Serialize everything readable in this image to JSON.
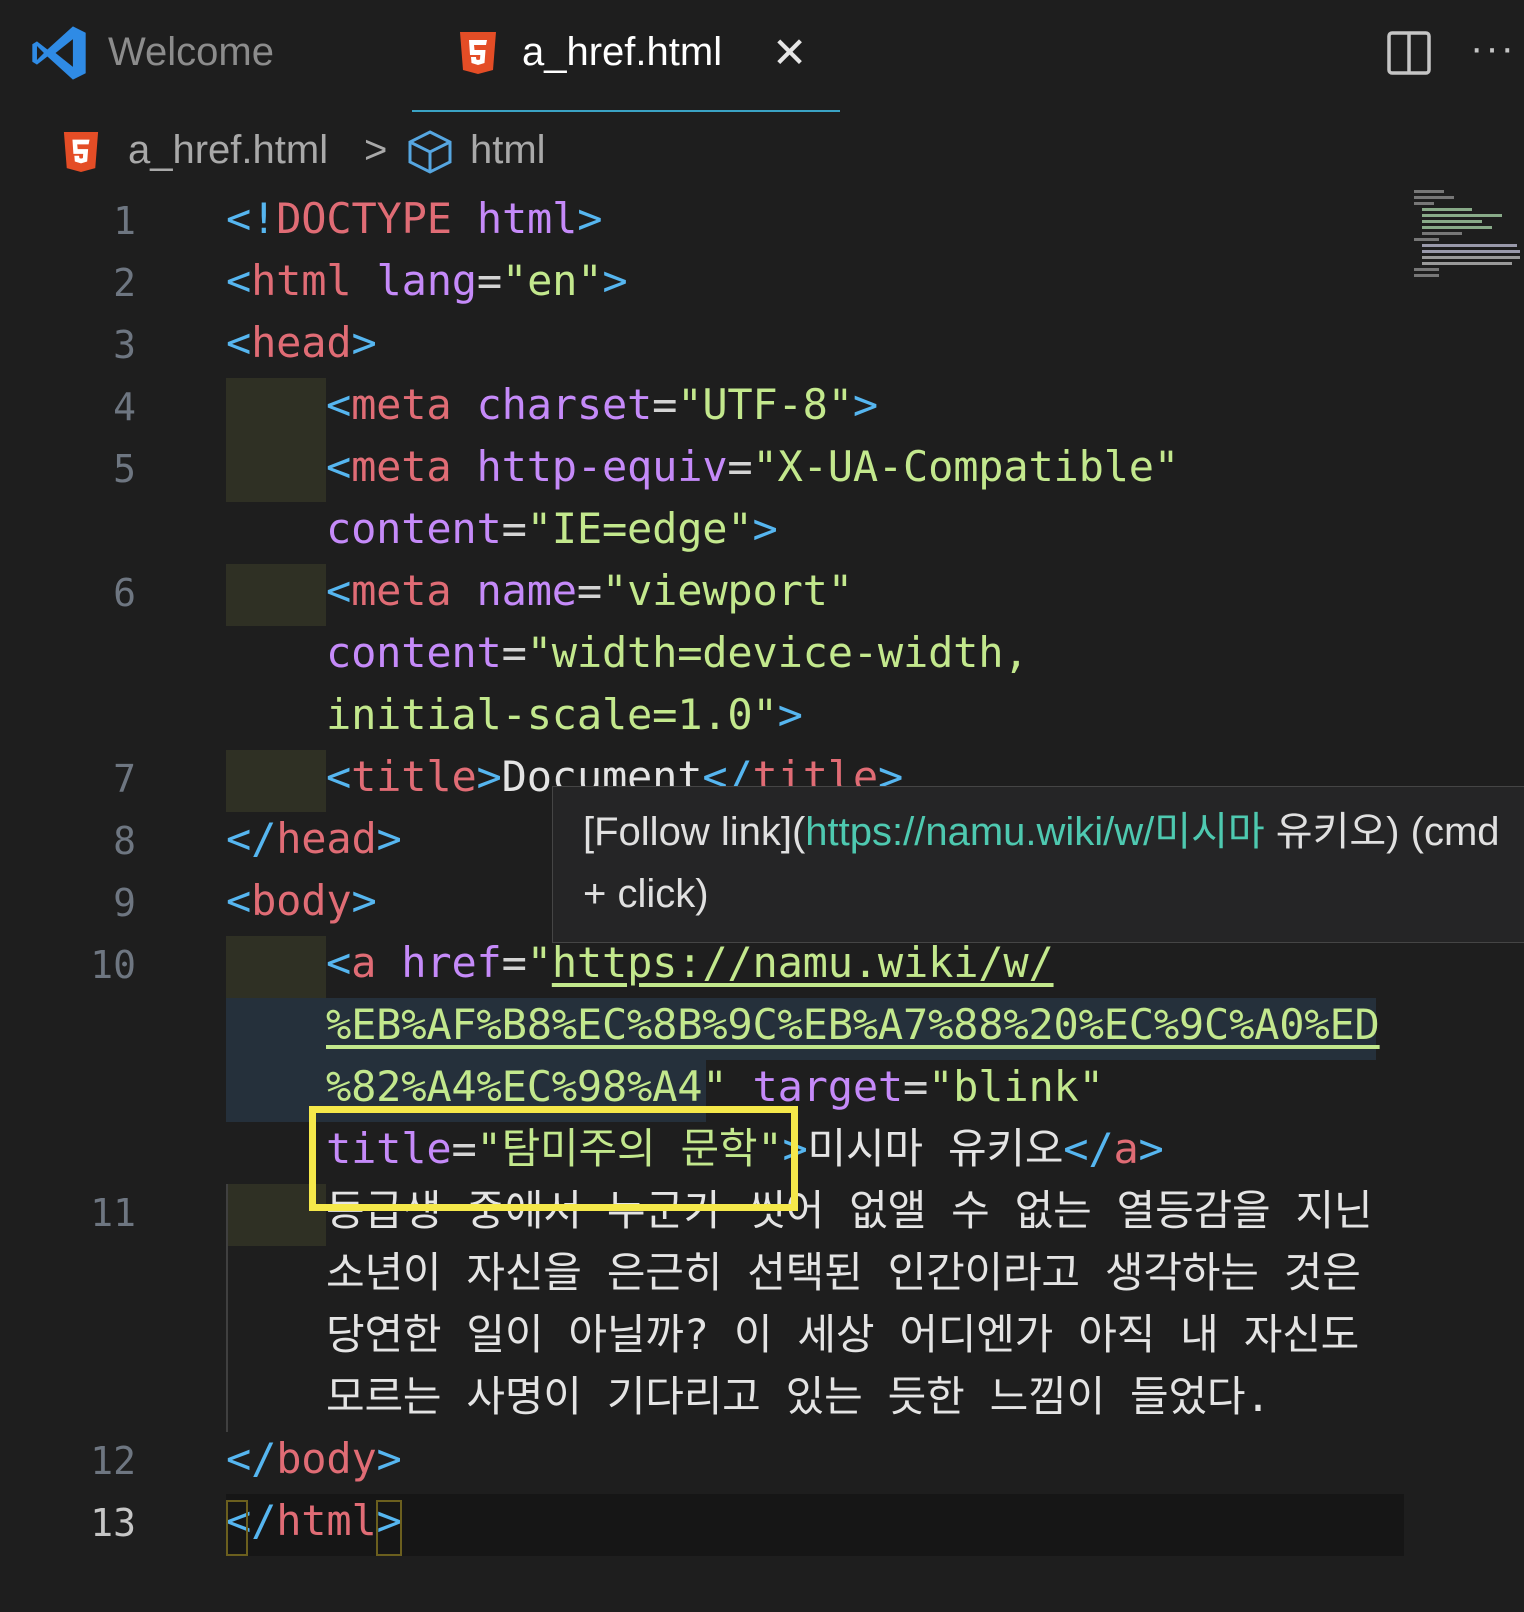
{
  "tabs": {
    "welcome_label": "Welcome",
    "active_label": "a_href.html",
    "close_symbol": "✕",
    "split_symbol": "◫",
    "more_symbol": "···"
  },
  "breadcrumb": {
    "file": "a_href.html",
    "separator": ">",
    "element": "html"
  },
  "line_numbers": [
    "1",
    "2",
    "3",
    "4",
    "5",
    "6",
    "7",
    "8",
    "9",
    "10",
    "11",
    "12",
    "13"
  ],
  "code": {
    "l1": [
      "<!",
      "DOCTYPE",
      " html",
      ">"
    ],
    "l2": [
      "<",
      "html",
      " lang",
      "=",
      "\"en\"",
      ">"
    ],
    "l3": [
      "<",
      "head",
      ">"
    ],
    "l4": [
      "<",
      "meta",
      " charset",
      "=",
      "\"UTF-8\"",
      ">"
    ],
    "l5a": [
      "<",
      "meta",
      " http-equiv",
      "=",
      "\"X-UA-Compatible\""
    ],
    "l5b": [
      "content",
      "=",
      "\"IE=edge\"",
      ">"
    ],
    "l6a": [
      "<",
      "meta",
      " name",
      "=",
      "\"viewport\""
    ],
    "l6b": [
      "content",
      "=",
      "\"width=device-width,"
    ],
    "l6c": [
      "initial-scale=1.0\"",
      ">"
    ],
    "l7": [
      "<",
      "title",
      ">",
      "Document",
      "</",
      "title",
      ">"
    ],
    "l8": [
      "</",
      "head",
      ">"
    ],
    "l9": [
      "<",
      "body",
      ">"
    ],
    "l10a": [
      "<",
      "a",
      " href",
      "=",
      "\"",
      "https://namu.wiki/w/"
    ],
    "l10b": [
      "%EB%AF%B8%EC%8B%9C%EB%A7%88%20%EC%9C%A0%ED"
    ],
    "l10c": [
      "%82%A4%EC%98%A4",
      "\"",
      " target",
      "=",
      "\"blink\""
    ],
    "l10d": [
      "title",
      "=",
      "\"탐미주의 문학\"",
      ">",
      "미시마 유키오",
      "</",
      "a",
      ">"
    ],
    "l11a": "동급생 중에서 누군가 씻어 없앨 수 없는 열등감을 지닌",
    "l11b": "소년이 자신을 은근히 선택된 인간이라고 생각하는 것은",
    "l11c": "당연한 일이 아닐까? 이 세상 어디엔가 아직 내 자신도",
    "l11d": "모르는 사명이 기다리고 있는 듯한 느낌이 들었다.",
    "l12": [
      "</",
      "body",
      ">"
    ],
    "l13": [
      "</",
      "html",
      ">"
    ]
  },
  "hover": {
    "prefix": "[Follow link](",
    "url": "https://namu.wiki/w/미시마",
    "suffix": " 유키오) (cmd",
    "line2": "+ click)"
  },
  "colors": {
    "background": "#1e1e1e",
    "highlight_box": "#f5e84a",
    "html5_icon": "#e44d26",
    "vscode_blue": "#2f8be5"
  },
  "icons": [
    "vscode-logo-icon",
    "html5-icon",
    "close-icon",
    "split-editor-icon",
    "more-actions-icon",
    "cube-icon"
  ]
}
